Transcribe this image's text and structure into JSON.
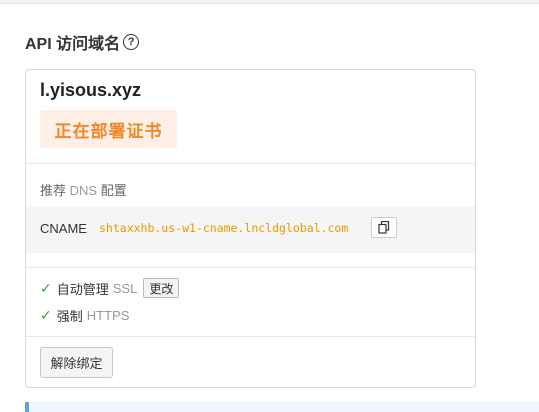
{
  "section": {
    "title": "API 访问域名",
    "help_icon": "?"
  },
  "domain_card": {
    "domain": "l.yisous.xyz",
    "status": "正在部署证书",
    "dns": {
      "title_main": "推荐",
      "title_dns": "DNS",
      "title_config": "配置",
      "record_type": "CNAME",
      "record_value": "shtaxxhb.us-w1-cname.lncldglobal.com",
      "copy_icon": "copy-icon"
    },
    "features": {
      "ssl": {
        "check_icon": "✓",
        "label": "自动管理",
        "protocol": "SSL",
        "change_label": "更改"
      },
      "https": {
        "check_icon": "✓",
        "label": "强制",
        "protocol": "HTTPS"
      }
    },
    "unbind_label": "解除绑定"
  },
  "colors": {
    "status_text": "#f0882a",
    "status_bg": "#fef0e6",
    "cname_value": "#e89a00",
    "check": "#3a9b3a",
    "info_border": "#5aa4e6"
  }
}
